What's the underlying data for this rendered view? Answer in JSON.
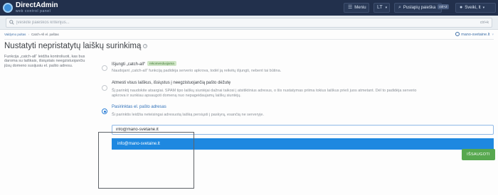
{
  "header": {
    "logo_title": "DirectAdmin",
    "logo_subtitle": "web control panel",
    "menu_label": "Meniu",
    "language_label": "LT",
    "search_label": "Puslapių paieška",
    "search_shortcut": "ctrl+Z",
    "user_label": "Sveiki, lt",
    "accent_color": "#22304c"
  },
  "searchbar": {
    "placeholder": "Įveskite paieškos kriterijus...",
    "shortcut": "ctrl+k"
  },
  "breadcrumb": {
    "items": [
      "Valdymo pultas",
      "Catch-All el. paštas"
    ],
    "site": "mano-svetaine.lt"
  },
  "page": {
    "title": "Nustatyti nepristatytų laiškų surinkimą",
    "description": "Funkcija „catch-all“ leidžia kontroliuoti, kas bus daroma su laiškais, išsiųstais neegzistuojančiu jūsų domeno susijusiu el. pašto adresu."
  },
  "options": [
    {
      "title": "Išjungti „catch-all“",
      "badge": "rekomenduojama",
      "subtitle": "Naudojant „catch-all“ funkciją padidėja serverio apkrova, todėl ją reikėtų išjungti, nebent tai būtina.",
      "selected": false
    },
    {
      "title": "Atmesti visus laiškus, išsiųstus į neegzistuojančią pašto dėžutę",
      "subtitle_line1": "Šį parinktį naudokite atsargiai. SPAM tipo laiškų siuntėjai dažnai taikosi į atsitiktinius adresus, o šis nustatymas priima tokius laiškus prieš juos atmetant. Dėl to padidėja serverio",
      "subtitle_line2": "apkrova ir sunkiau apsaugoti domeną nuo nepageidaujamų laiškų siuntėjų.",
      "selected": false
    },
    {
      "title": "Pasirinktas el. pašto adresas",
      "subtitle": "Ši parinktis leidžia neteisingai adresuotą laišką persiųsti į paskyrą, esančią ne serveryje.",
      "selected": true
    }
  ],
  "email": {
    "value": "info@mano-svetaine.lt",
    "suggestion": "info@mano-svetaine.lt"
  },
  "save_label": "IŠSAUGOTI"
}
